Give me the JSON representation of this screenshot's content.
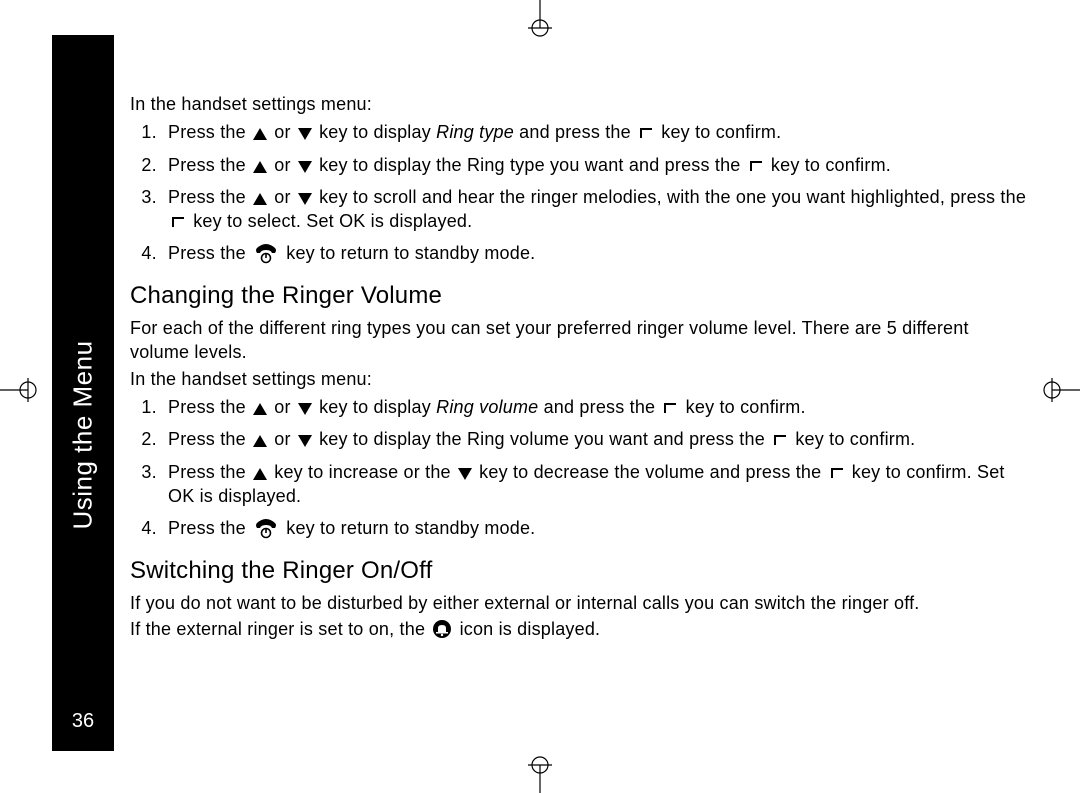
{
  "sidebar": {
    "title": "Using the Menu",
    "page_number": "36"
  },
  "words": {
    "press_the": "Press the",
    "or": "or",
    "key_to_confirm": "key to confirm.",
    "key_to": "key to",
    "confirm": "confirm.",
    "ring_type_italic": "Ring type",
    "ring_volume_italic": "Ring volume",
    "to_confirm": "to confirm."
  },
  "section1": {
    "intro": "In the handset settings menu:",
    "s1_p1": "key to display",
    "s1_p2": "and press the",
    "s2_p1": "key to display the Ring type you want and press the",
    "s3_p1": "key to scroll and hear the ringer melodies, with the one you want highlighted, press the",
    "s3_p2": "key to select. Set OK is displayed.",
    "s4_p1": "key to return to standby mode."
  },
  "section2": {
    "heading": "Changing the Ringer Volume",
    "intro1": "For each of the different ring types you can set your preferred ringer volume level. There are 5 different volume levels.",
    "intro2": "In the handset settings menu:",
    "s1_p1": "key to display",
    "s1_p2": "and press the",
    "s2_p1": "key to display the Ring volume you want and press the",
    "s2_p2": "key",
    "s3_p1": "key to increase or the",
    "s3_p2": "key to decrease the volume and press the",
    "s3_p3": "key to confirm. Set OK is displayed.",
    "s4_p1": "key to return to standby mode."
  },
  "section3": {
    "heading": "Switching the Ringer On/Off",
    "intro1": "If you do not want to be disturbed by either external or internal calls you can switch the ringer off.",
    "intro2a": "If the external ringer is set to on, the",
    "intro2b": "icon is displayed."
  }
}
